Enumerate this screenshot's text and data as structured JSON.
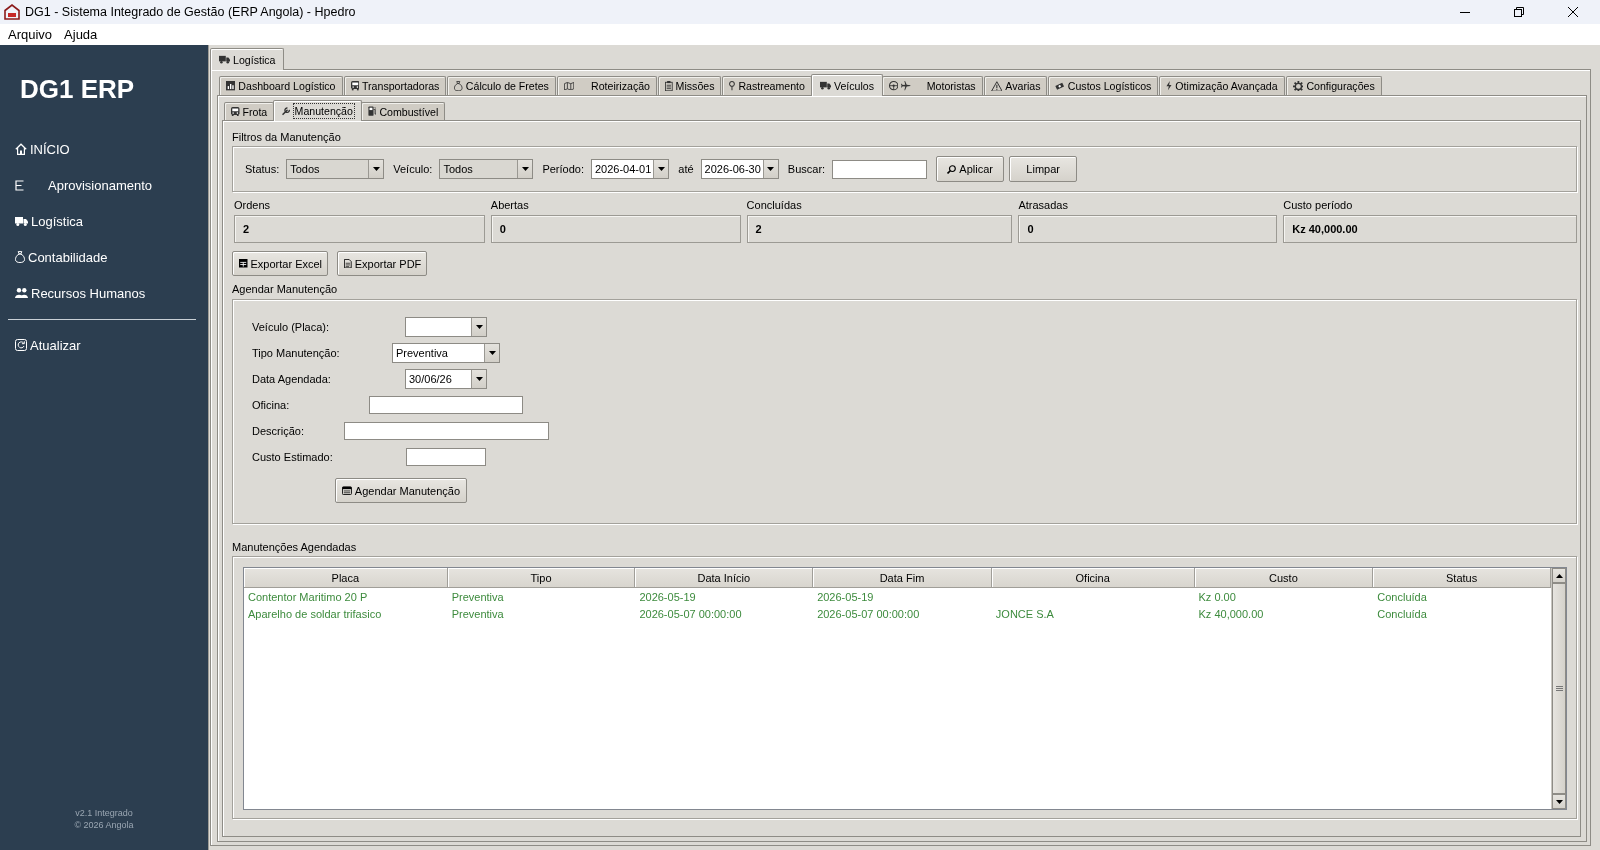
{
  "window": {
    "title": "DG1 - Sistema Integrado de Gestão (ERP Angola) - Hpedro"
  },
  "menu": [
    "Arquivo",
    "Ajuda"
  ],
  "sidebar": {
    "logo": "DG1 ERP",
    "items": [
      "INÍCIO",
      "Aprovisionamento",
      "Logística",
      "Contabilidade",
      "Recursos Humanos"
    ],
    "refresh": "Atualizar",
    "footer": [
      "v2.1 Integrado",
      "© 2026 Angola"
    ]
  },
  "module_tabs": [
    {
      "label": "Logística",
      "selected": true
    }
  ],
  "logistics_tabs": [
    {
      "label": "Dashboard Logístico",
      "selected": false
    },
    {
      "label": "Transportadoras",
      "selected": false
    },
    {
      "label": "Cálculo de Fretes",
      "selected": false
    },
    {
      "label": "Roteirização",
      "selected": false
    },
    {
      "label": "Missões",
      "selected": false
    },
    {
      "label": "Rastreamento",
      "selected": false
    },
    {
      "label": "Veículos",
      "selected": true
    },
    {
      "label": "Motoristas",
      "selected": false
    },
    {
      "label": "Avarias",
      "selected": false
    },
    {
      "label": "Custos Logísticos",
      "selected": false
    },
    {
      "label": "Otimização Avançada",
      "selected": false
    },
    {
      "label": "Configurações",
      "selected": false
    }
  ],
  "vehicle_tabs": [
    {
      "label": "Frota",
      "selected": false
    },
    {
      "label": "Manutenção",
      "selected": true
    },
    {
      "label": "Combustível",
      "selected": false
    }
  ],
  "filters": {
    "title": "Filtros da Manutenção",
    "fields": [
      {
        "kind": "select",
        "label": "Status:",
        "value": "Todos"
      },
      {
        "kind": "select",
        "label": "Veículo:",
        "value": "Todos"
      },
      {
        "kind": "date",
        "label": "Período:",
        "value": "2026-04-01"
      },
      {
        "kind": "date",
        "label": "até",
        "value": "2026-06-30"
      },
      {
        "kind": "text",
        "label": "Buscar:"
      }
    ],
    "buttons": [
      "Aplicar",
      "Limpar"
    ]
  },
  "stats": [
    {
      "label": "Ordens",
      "value": "2"
    },
    {
      "label": "Abertas",
      "value": "0"
    },
    {
      "label": "Concluídas",
      "value": "2"
    },
    {
      "label": "Atrasadas",
      "value": "0"
    },
    {
      "label": "Custo período",
      "value": "Kz 40,000.00"
    }
  ],
  "export_buttons": [
    "Exportar Excel",
    "Exportar PDF"
  ],
  "schedule": {
    "title": "Agendar Manutenção",
    "fields": [
      {
        "kind": "combo",
        "label": "Veículo (Placa):"
      },
      {
        "kind": "combo",
        "label": "Tipo Manutenção:",
        "value": "Preventiva"
      },
      {
        "kind": "date",
        "label": "Data Agendada:",
        "value": "30/06/26"
      },
      {
        "kind": "text",
        "label": "Oficina:"
      },
      {
        "kind": "text",
        "label": "Descrição:"
      },
      {
        "kind": "text",
        "label": "Custo Estimado:"
      }
    ],
    "button": "Agendar Manutenção"
  },
  "schedule_table": {
    "title": "Manutenções Agendadas",
    "columns": [
      "Placa",
      "Tipo",
      "Data Início",
      "Data Fim",
      "Oficina",
      "Custo",
      "Status"
    ],
    "rows": [
      {
        "placa": "Contentor Maritimo 20 P",
        "tipo": "Preventiva",
        "data_inicio": "2026-05-19",
        "data_fim": "2026-05-19",
        "custo": "Kz 0.00",
        "status": "Concluída"
      },
      {
        "placa": "Aparelho de soldar trifasico",
        "tipo": "Preventiva",
        "data_inicio": "2026-05-07 00:00:00",
        "data_fim": "2026-05-07 00:00:00",
        "oficina": "JONCE S.A",
        "custo": "Kz 40,000.00",
        "status": "Concluída"
      }
    ]
  }
}
